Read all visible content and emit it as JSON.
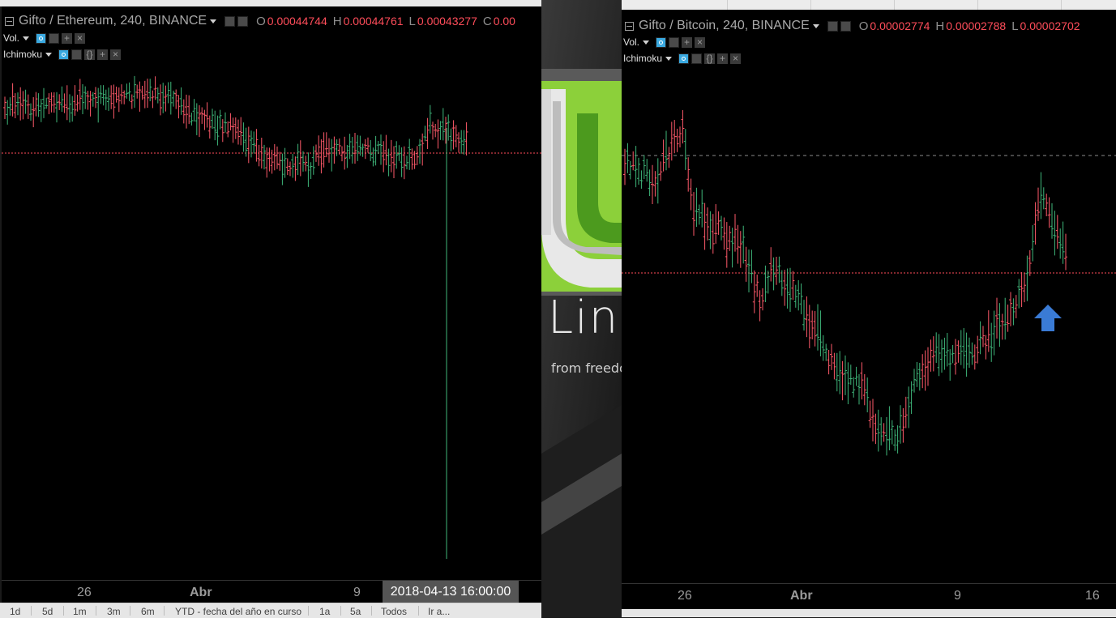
{
  "left_chart": {
    "symbol": "Gifto / Ethereum, 240, BINANCE",
    "ohlc": [
      {
        "key": "O",
        "value": "0.00044744"
      },
      {
        "key": "H",
        "value": "0.00044761"
      },
      {
        "key": "L",
        "value": "0.00043277"
      },
      {
        "key": "C",
        "value": "0.00"
      }
    ],
    "studies": [
      {
        "label": "Vol."
      },
      {
        "label": "Ichimoku"
      }
    ],
    "x_labels": [
      {
        "text": "26",
        "bold": false
      },
      {
        "text": "Abr",
        "bold": true
      },
      {
        "text": "9",
        "bold": false
      }
    ],
    "cursor_time": "2018-04-13 16:00:00",
    "range_buttons": [
      "1d",
      "5d",
      "1m",
      "3m",
      "6m",
      "YTD - fecha del año en curso",
      "1a",
      "5a",
      "Todos",
      "Ir a..."
    ]
  },
  "right_chart": {
    "symbol": "Gifto / Bitcoin, 240, BINANCE",
    "ohlc": [
      {
        "key": "O",
        "value": "0.00002774"
      },
      {
        "key": "H",
        "value": "0.00002788"
      },
      {
        "key": "L",
        "value": "0.00002702"
      }
    ],
    "studies": [
      {
        "label": "Vol."
      },
      {
        "label": "Ichimoku"
      }
    ],
    "x_labels": [
      {
        "text": "26",
        "bold": false
      },
      {
        "text": "Abr",
        "bold": true
      },
      {
        "text": "9",
        "bold": false
      },
      {
        "text": "16",
        "bold": false
      }
    ]
  },
  "desktop": {
    "brand_word": "Linux",
    "brand_tagline": "from freedom"
  },
  "colors": {
    "up_bar": "#3fb77a",
    "down_bar": "#ff5a6a",
    "price_line": "#ff4d5a",
    "arrow": "#3a7bd5",
    "mint_green": "#6fbe2a"
  },
  "icons": [
    "collapse-icon",
    "eye-icon",
    "gear-icon",
    "plus-icon",
    "close-icon",
    "braces-icon",
    "dropdown-caret-icon",
    "up-arrow-icon"
  ]
}
